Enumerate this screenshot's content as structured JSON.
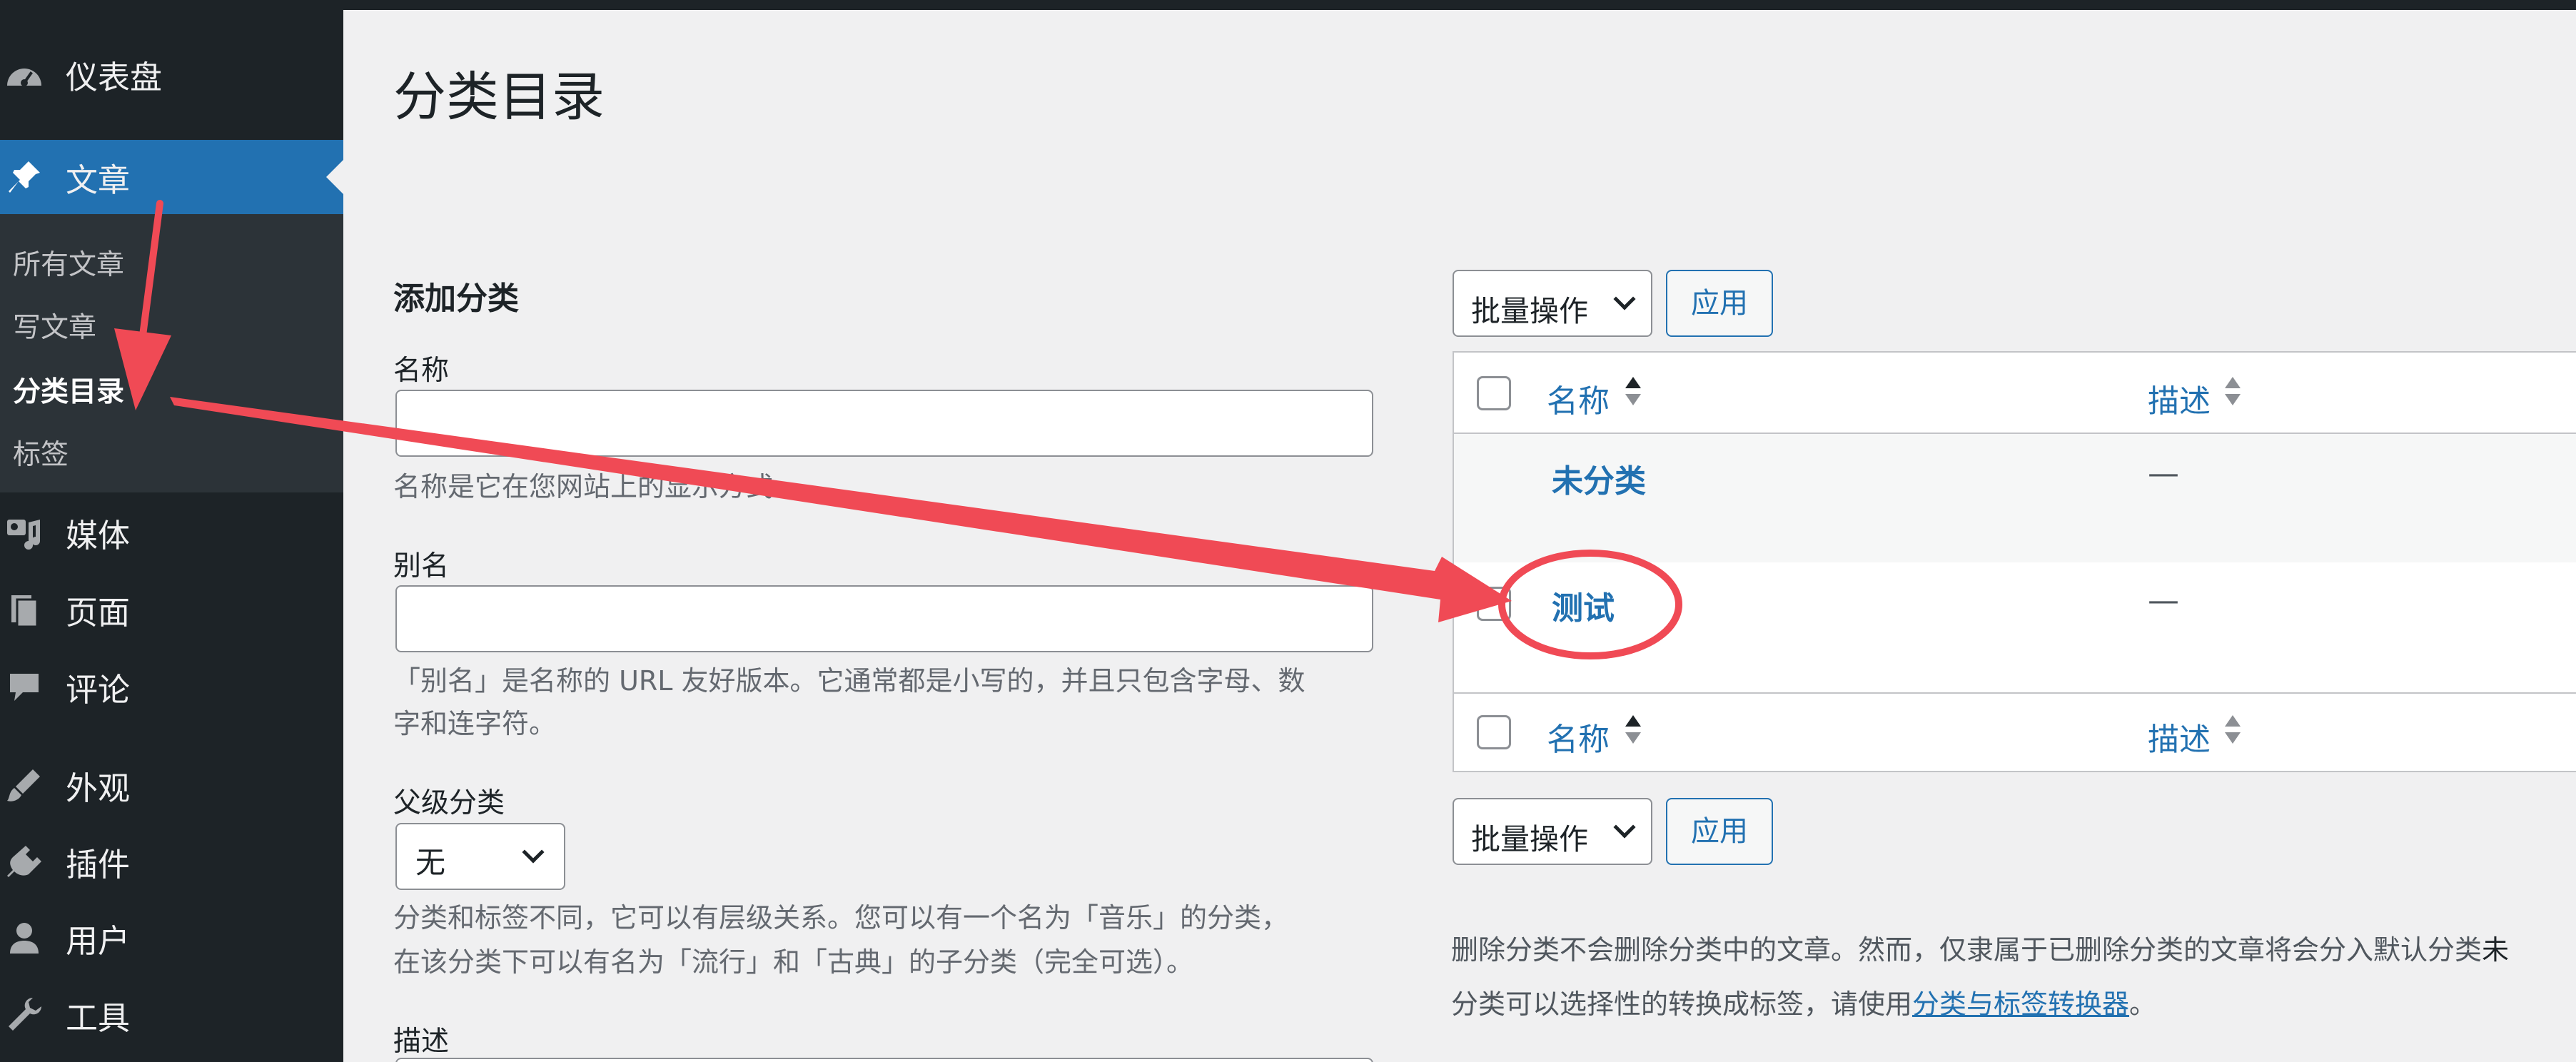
{
  "sidebar": {
    "items": [
      {
        "label": "仪表盘",
        "icon": "dashboard-icon"
      },
      {
        "label": "文章",
        "icon": "pin-icon"
      },
      {
        "label": "媒体",
        "icon": "media-icon"
      },
      {
        "label": "页面",
        "icon": "pages-icon"
      },
      {
        "label": "评论",
        "icon": "comments-icon"
      },
      {
        "label": "外观",
        "icon": "appearance-icon"
      },
      {
        "label": "插件",
        "icon": "plugins-icon"
      },
      {
        "label": "用户",
        "icon": "users-icon"
      },
      {
        "label": "工具",
        "icon": "tools-icon"
      }
    ],
    "submenu": [
      "所有文章",
      "写文章",
      "分类目录",
      "标签"
    ]
  },
  "page": {
    "title": "分类目录"
  },
  "form": {
    "section_title": "添加分类",
    "name_label": "名称",
    "name_help": "名称是它在您网站上的显示方式。",
    "slug_label": "别名",
    "slug_help_1": "「别名」是名称的 URL 友好版本。它通常都是小写的，并且只包含字母、数",
    "slug_help_2": "字和连字符。",
    "parent_label": "父级分类",
    "parent_value": "无",
    "parent_help_1": "分类和标签不同，它可以有层级关系。您可以有一个名为「音乐」的分类，",
    "parent_help_2": "在该分类下可以有名为「流行」和「古典」的子分类（完全可选）。",
    "desc_label": "描述"
  },
  "bulk": {
    "select_label": "批量操作",
    "apply_label": "应用"
  },
  "table": {
    "col_name": "名称",
    "col_desc": "描述",
    "rows": [
      {
        "name": "未分类",
        "desc": "—"
      },
      {
        "name": "测试",
        "desc": "—"
      }
    ]
  },
  "notes": {
    "line1": "删除分类不会删除分类中的文章。然而，仅隶属于已删除分类的文章将会分入默认分类",
    "line1_tail": "未",
    "line2_prefix": "分类可以选择性的转换成标签，请使用",
    "line2_link": "分类与标签转换器",
    "line2_suffix": "。"
  },
  "colors": {
    "admin_dark": "#1d2327",
    "admin_blue": "#2271b1",
    "annotation_red": "#f04a55"
  }
}
